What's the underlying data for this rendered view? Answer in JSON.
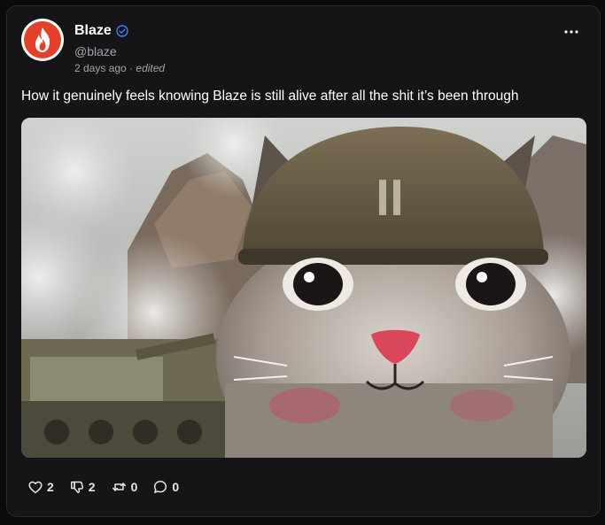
{
  "post": {
    "author": {
      "name": "Blaze",
      "handle": "@blaze",
      "verified": true,
      "avatar_icon": "flame-logo"
    },
    "timestamp": "2 days ago",
    "separator": "·",
    "edited_label": "edited",
    "more_icon": "ellipsis-icon",
    "text": "How it genuinely feels knowing Blaze is still alive after all the shit it’s been through",
    "media": {
      "type": "image"
    },
    "actions": {
      "likes": "2",
      "dislikes": "2",
      "reposts": "0",
      "comments": "0"
    }
  },
  "colors": {
    "background": "#0b0b0c",
    "card": "#151517",
    "brand_red": "#e2402a",
    "verified_blue": "#3b82f6",
    "muted_text": "#a2a2a8"
  }
}
